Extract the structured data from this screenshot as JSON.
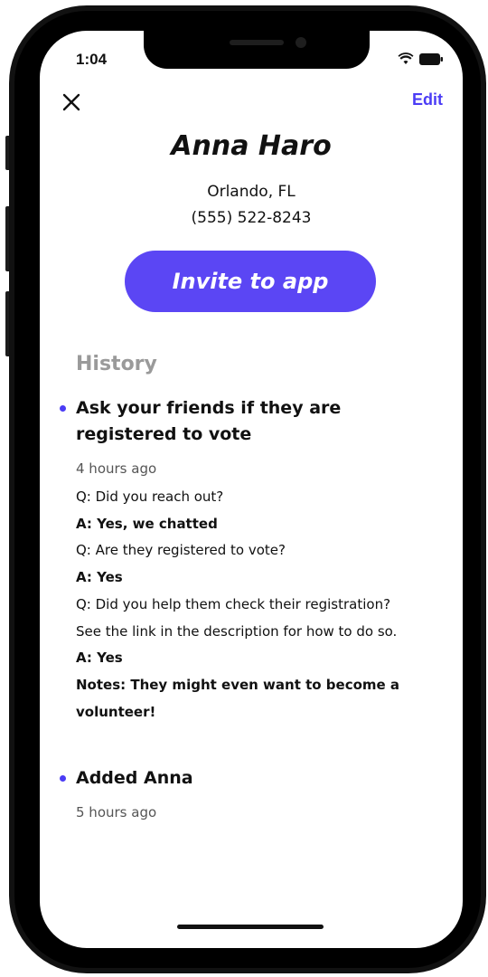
{
  "status_bar": {
    "time": "1:04",
    "icons": [
      "wifi-icon",
      "battery-icon"
    ]
  },
  "header": {
    "close_icon": "close-icon",
    "edit_label": "Edit"
  },
  "contact": {
    "name": "Anna Haro",
    "location": "Orlando, FL",
    "phone": "(555) 522-8243"
  },
  "invite_button": {
    "label": "Invite to app"
  },
  "history": {
    "title": "History",
    "entries": [
      {
        "title": "Ask your friends if they are registered to vote",
        "time": "4 hours ago",
        "lines": [
          "Q: Did you reach out?",
          "A: Yes, we chatted",
          "Q: Are they registered to vote?",
          "A: Yes",
          "Q: Did you help them check their registration?",
          "See the link in the description for how to do so.",
          "A: Yes",
          "Notes: They might even want to become a",
          "volunteer!"
        ]
      },
      {
        "title": "Added Anna",
        "time": "5 hours ago"
      }
    ]
  },
  "colors": {
    "accent": "#5b46f4",
    "link": "#4b3cf5",
    "muted": "#9a9a9a"
  }
}
